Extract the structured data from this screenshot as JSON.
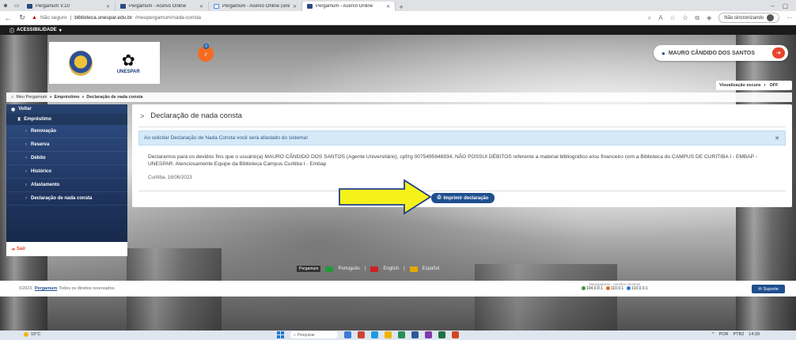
{
  "browser": {
    "tabs": [
      {
        "label": "Pergamum V.10",
        "active": false
      },
      {
        "label": "Pergamum - Acervo Online",
        "active": false
      },
      {
        "label": "Pergamum - Acervo Online (unes",
        "active": false
      },
      {
        "label": "Pergamum - Acervo Online",
        "active": true
      }
    ],
    "security_label": "Não seguro",
    "url_host": "biblioteca.unespar.edu.br",
    "url_path": "/meupergamum/nada-consta",
    "sync_label": "Não sincronizando"
  },
  "accessibility": {
    "label": "ACESSIBILIDADE"
  },
  "header": {
    "logo_text": "UNESPAR",
    "notification_count": "0",
    "user_name": "MAURO CÂNDIDO DOS SANTOS",
    "dark_mode_label": "Visualização escura",
    "dark_mode_state": "OFF"
  },
  "breadcrumb": {
    "root": "Meu Pergamum",
    "section": "Empréstimo",
    "current": "Declaração de nada consta"
  },
  "sidebar": {
    "back_label": "Voltar",
    "group_label": "Empréstimo",
    "items": [
      {
        "label": "Renovação"
      },
      {
        "label": "Reserva"
      },
      {
        "label": "Débito"
      },
      {
        "label": "Histórico"
      },
      {
        "label": "Afastamento"
      },
      {
        "label": "Declaração de nada consta"
      }
    ],
    "exit_label": "Sair"
  },
  "main": {
    "title": "Declaração de nada consta",
    "alert": "Ao solicitar Declaração de Nada Consta você será afastado do sistema!",
    "declaration": "Declaramos para os devidos fins que o usuário(a) MAURO CÂNDIDO DOS SANTOS (Agente Universitário), cpf/rg 0075495848934, NÃO POSSUI DÉBITOS referente a material bibliográfico e/ou financeiro com a Biblioteca do CAMPUS DE CURITIBA I - EMBAP - UNESPAR. Atenciosamente Equipe da Biblioteca Campus Curitiba I - Embap",
    "date": "Curitiba, 16/06/2023",
    "print_label": "Imprimir declaração"
  },
  "languages": {
    "brand": "Pergamum",
    "items": [
      {
        "label": "Português"
      },
      {
        "label": "English"
      },
      {
        "label": "Español"
      }
    ]
  },
  "footer": {
    "copyright_prefix": "©2023.",
    "brand": "Pergamum",
    "copyright_suffix": "Todos os direitos reservados.",
    "browsers_label": "Navegadores - versões mínimas",
    "browser_versions": [
      "104.0.0.1",
      "110.0.1",
      "110.0.0.1"
    ],
    "support_label": "Suporte"
  },
  "taskbar": {
    "temperature": "15°C",
    "search_placeholder": "Pesquisar",
    "lang": "POR",
    "lang2": "PTB2",
    "time": "14:39"
  },
  "colors": {
    "brand_blue": "#1f4f8f",
    "accent_orange": "#f36c21",
    "alert_bg": "#d6e9f7",
    "arrow_yellow": "#f5f21a"
  }
}
